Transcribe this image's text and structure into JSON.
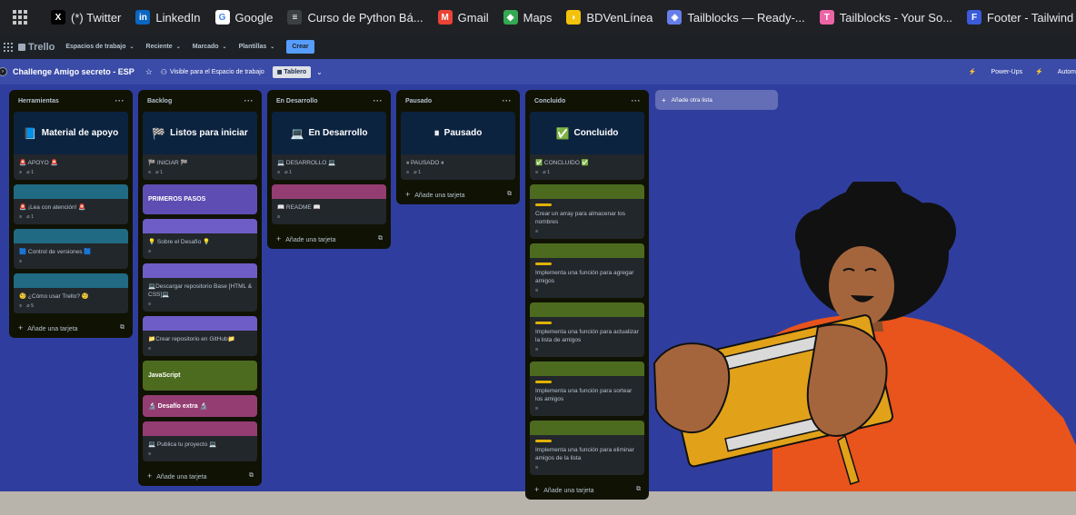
{
  "bookmarks": [
    {
      "label": "(*) Twitter",
      "icon": "x-logo-icon",
      "color": "#000000",
      "glyph": "X"
    },
    {
      "label": "LinkedIn",
      "icon": "linkedin-icon",
      "color": "#0a66c2",
      "glyph": "in"
    },
    {
      "label": "Google",
      "icon": "google-icon",
      "color": "#ffffff",
      "glyph": "G"
    },
    {
      "label": "Curso de Python Bá...",
      "icon": "python-course-icon",
      "color": "#3c4043",
      "glyph": "≡"
    },
    {
      "label": "Gmail",
      "icon": "gmail-icon",
      "color": "#ea4335",
      "glyph": "M"
    },
    {
      "label": "Maps",
      "icon": "maps-icon",
      "color": "#34a853",
      "glyph": "◆"
    },
    {
      "label": "BDVenLínea",
      "icon": "bdv-icon",
      "color": "#f4c20d",
      "glyph": "◗"
    },
    {
      "label": "Tailblocks — Ready-...",
      "icon": "tailblocks-icon",
      "color": "#667eea",
      "glyph": "◈"
    },
    {
      "label": "Tailblocks - Your So...",
      "icon": "tailblocks-pink-icon",
      "color": "#ed64a6",
      "glyph": "T"
    },
    {
      "label": "Footer - Tailwind CS...",
      "icon": "tailwind-icon",
      "color": "#3b5bdb",
      "glyph": "F"
    }
  ],
  "trello": {
    "logo": "Trello",
    "menus": [
      "Espacios de trabajo",
      "Reciente",
      "Marcado",
      "Plantillas"
    ],
    "create": "Crear"
  },
  "board": {
    "title": "Challenge Amigo secreto - ESP",
    "visibility": "Visible para el Espacio de trabajo",
    "view": "Tablero",
    "power_ups": "Power-Ups",
    "automation": "Autom"
  },
  "add_list": "Añade otra lista",
  "add_card": "Añade una tarjeta",
  "lists": {
    "herramientas": {
      "title": "Herramientas",
      "cover": {
        "title": "Material de apoyo",
        "icon": "📘",
        "bg": "#0c2340"
      },
      "card1": {
        "title": "🚨 APOYO 🚨",
        "attach": "1"
      },
      "card2": {
        "title": "🚨 ¡Lea con atención! 🚨",
        "attach": "1",
        "strip": "#206a83"
      },
      "card3": {
        "title": "🟦 Control de versiones 🟦",
        "strip": "#206a83"
      },
      "card4": {
        "title": "🧐 ¿Cómo usar Trello? 🧐",
        "attach": "5",
        "strip": "#206a83"
      }
    },
    "backlog": {
      "title": "Backlog",
      "cover": {
        "title": "Listos para iniciar",
        "icon": "🏁",
        "bg": "#0c2340"
      },
      "card1": {
        "title": "🏁 INICIAR 🏁",
        "attach": "1"
      },
      "section1": {
        "title": "PRIMEROS PASOS",
        "bg": "#5e4db2"
      },
      "card2": {
        "title": "💡 Sobre el Desafío 💡",
        "strip": "#6e5dc6"
      },
      "card3": {
        "title": "💻Descargar repositorio Base [HTML & CSS]💻",
        "strip": "#6e5dc6"
      },
      "card4": {
        "title": "📁Crear repositorio en GitHub📁",
        "strip": "#6e5dc6"
      },
      "section2": {
        "title": "JavaScript",
        "bg": "#4c6b1f"
      },
      "section3": {
        "title": "🔬 Desafío extra 🔬",
        "bg": "#943d73"
      },
      "card5": {
        "title": "💻 Publica tu proyecto 💻",
        "strip": "#943d73"
      }
    },
    "desarrollo": {
      "title": "En Desarrollo",
      "cover": {
        "title": "En Desarrollo",
        "icon": "💻",
        "bg": "#0c2340"
      },
      "card1": {
        "title": "💻 DESARROLLO 💻",
        "attach": "1"
      },
      "card2": {
        "title": "📖 README 📖",
        "strip": "#943d73"
      }
    },
    "pausado": {
      "title": "Pausado",
      "cover": {
        "title": "Pausado",
        "icon": "⏸",
        "bg": "#0c2340"
      },
      "card1": {
        "title": "⏸ PAUSADO ⏸",
        "attach": "1"
      }
    },
    "concluido": {
      "title": "Concluido",
      "cover": {
        "title": "Concluido",
        "icon": "✅",
        "bg": "#0c2340"
      },
      "card1": {
        "title": "✅ CONCLUIDO ✅",
        "attach": "1"
      },
      "card2": {
        "title": "Crear un array para almacenar los nombres",
        "strip": "#4c6b1f"
      },
      "card3": {
        "title": "Implementa una función para agregar amigos",
        "strip": "#4c6b1f"
      },
      "card4": {
        "title": "Implementa una función para actualizar la lista de amigos",
        "strip": "#4c6b1f"
      },
      "card5": {
        "title": "Implementa una función para sortear los amigos",
        "strip": "#4c6b1f"
      },
      "card6": {
        "title": "Implementa una función para eliminar amigos de la lista",
        "strip": "#4c6b1f"
      }
    }
  },
  "colors": {
    "board_bg": "#2f3e9e",
    "list_bg": "#101204",
    "card_bg": "#22272b",
    "label_yellow": "#e2b203"
  }
}
